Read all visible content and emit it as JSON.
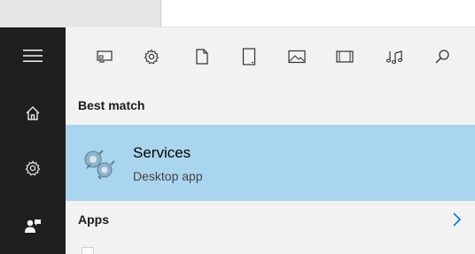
{
  "sections": {
    "best_match_label": "Best match",
    "apps_label": "Apps"
  },
  "best_match": {
    "title": "Services",
    "subtitle": "Desktop app"
  },
  "rail_icons": [
    "menu-icon",
    "home-icon",
    "gear-icon",
    "feedback-icon"
  ],
  "filter_icons": [
    "apps-icon",
    "settings-icon",
    "documents-icon",
    "tablet-icon",
    "photos-icon",
    "videos-icon",
    "music-icon",
    "search-icon"
  ],
  "colors": {
    "rail_bg": "#1f1f1f",
    "panel_bg": "#f2f2f2",
    "highlight_bg": "#aad5ef",
    "accent": "#0078d7"
  }
}
